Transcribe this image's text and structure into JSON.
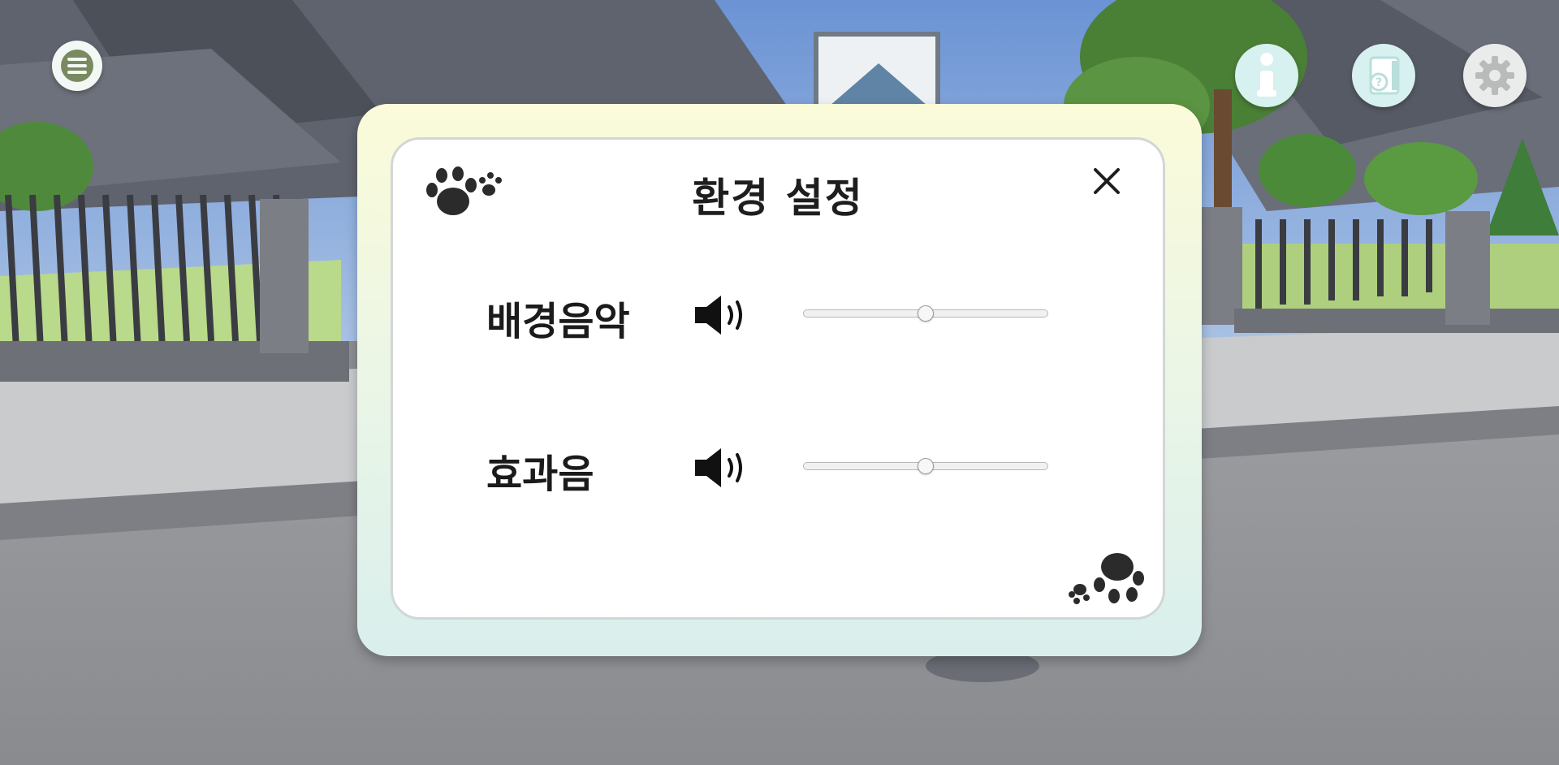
{
  "hud": {
    "menu_icon": "hamburger-menu-icon",
    "info_icon": "info-icon",
    "guide_icon": "guide-book-icon",
    "settings_icon": "gear-icon"
  },
  "dialog": {
    "title": "환경 설정",
    "close_icon": "close-icon",
    "settings": [
      {
        "label": "배경음악",
        "icon": "speaker-icon",
        "volume": 0.5
      },
      {
        "label": "효과음",
        "icon": "speaker-icon",
        "volume": 0.5
      }
    ]
  },
  "colors": {
    "dialog_top": "#fbfbd9",
    "dialog_bottom": "#d9efec",
    "hud_button": "#d6f1ef",
    "text": "#1e1e1e"
  }
}
